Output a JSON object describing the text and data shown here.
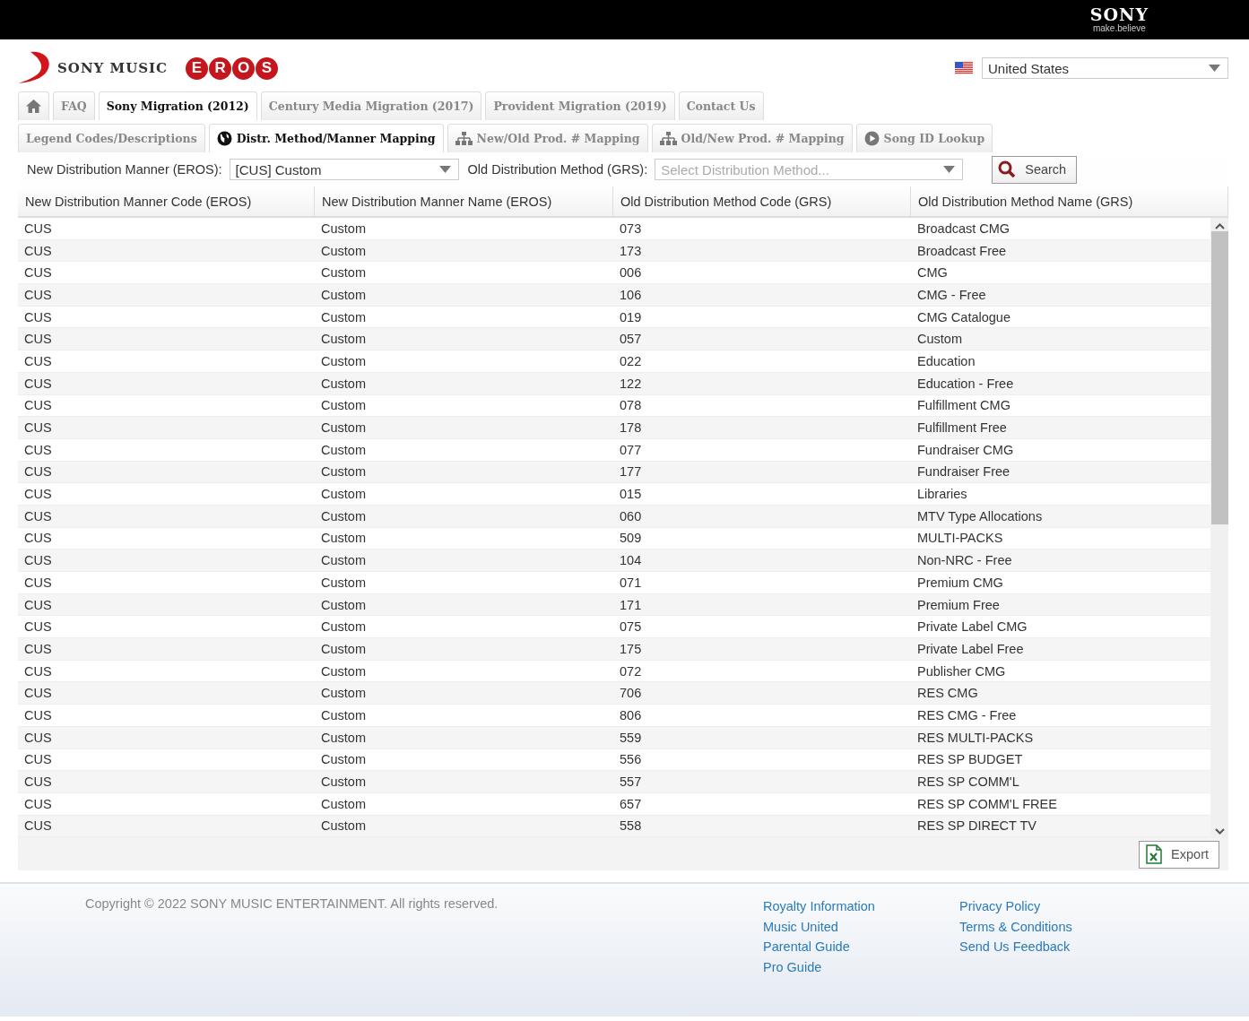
{
  "top_bar": {
    "brand": "SONY",
    "tagline": "make.believe"
  },
  "header": {
    "company": "SONY MUSIC",
    "product_letters": [
      "E",
      "R",
      "O",
      "S"
    ],
    "country": {
      "value": "United States"
    }
  },
  "main_tabs": [
    {
      "kind": "icon",
      "selected": false
    },
    {
      "kind": "text",
      "label": "FAQ",
      "selected": false
    },
    {
      "kind": "text",
      "label": "Sony Migration (2012)",
      "selected": true
    },
    {
      "kind": "text",
      "label": "Century Media Migration (2017)",
      "selected": false
    },
    {
      "kind": "text",
      "label": "Provident Migration (2019)",
      "selected": false
    },
    {
      "kind": "text",
      "label": "Contact Us",
      "selected": false
    }
  ],
  "sub_tabs": [
    {
      "label": "Legend Codes/Descriptions",
      "selected": false
    },
    {
      "label": "Distr. Method/Manner Mapping",
      "selected": true
    },
    {
      "label": "New/Old Prod. # Mapping",
      "selected": false
    },
    {
      "label": "Old/New Prod. # Mapping",
      "selected": false
    },
    {
      "label": "Song ID Lookup",
      "selected": false
    }
  ],
  "filters": [
    {
      "label": "New Distribution Manner (EROS):",
      "value": "[CUS] Custom"
    },
    {
      "label": "Old Distribution Method (GRS):",
      "placeholder": "Select Distribution Method..."
    }
  ],
  "search_button": "Search",
  "table": {
    "columns": [
      "New Distribution Manner Code (EROS)",
      "New Distribution Manner Name (EROS)",
      "Old Distribution Method Code (GRS)",
      "Old Distribution Method Name (GRS)"
    ],
    "rows": [
      [
        "CUS",
        "Custom",
        "073",
        "Broadcast CMG"
      ],
      [
        "CUS",
        "Custom",
        "173",
        "Broadcast Free"
      ],
      [
        "CUS",
        "Custom",
        "006",
        "CMG"
      ],
      [
        "CUS",
        "Custom",
        "106",
        "CMG - Free"
      ],
      [
        "CUS",
        "Custom",
        "019",
        "CMG Catalogue"
      ],
      [
        "CUS",
        "Custom",
        "057",
        "Custom"
      ],
      [
        "CUS",
        "Custom",
        "022",
        "Education"
      ],
      [
        "CUS",
        "Custom",
        "122",
        "Education - Free"
      ],
      [
        "CUS",
        "Custom",
        "078",
        "Fulfillment CMG"
      ],
      [
        "CUS",
        "Custom",
        "178",
        "Fulfillment Free"
      ],
      [
        "CUS",
        "Custom",
        "077",
        "Fundraiser CMG"
      ],
      [
        "CUS",
        "Custom",
        "177",
        "Fundraiser Free"
      ],
      [
        "CUS",
        "Custom",
        "015",
        "Libraries"
      ],
      [
        "CUS",
        "Custom",
        "060",
        "MTV Type Allocations"
      ],
      [
        "CUS",
        "Custom",
        "509",
        "MULTI-PACKS"
      ],
      [
        "CUS",
        "Custom",
        "104",
        "Non-NRC - Free"
      ],
      [
        "CUS",
        "Custom",
        "071",
        "Premium CMG"
      ],
      [
        "CUS",
        "Custom",
        "171",
        "Premium Free"
      ],
      [
        "CUS",
        "Custom",
        "075",
        "Private Label CMG"
      ],
      [
        "CUS",
        "Custom",
        "175",
        "Private Label Free"
      ],
      [
        "CUS",
        "Custom",
        "072",
        "Publisher CMG"
      ],
      [
        "CUS",
        "Custom",
        "706",
        "RES CMG"
      ],
      [
        "CUS",
        "Custom",
        "806",
        "RES CMG - Free"
      ],
      [
        "CUS",
        "Custom",
        "559",
        "RES MULTI-PACKS"
      ],
      [
        "CUS",
        "Custom",
        "556",
        "RES SP BUDGET"
      ],
      [
        "CUS",
        "Custom",
        "557",
        "RES SP COMM'L"
      ],
      [
        "CUS",
        "Custom",
        "657",
        "RES SP COMM'L FREE"
      ],
      [
        "CUS",
        "Custom",
        "558",
        "RES SP DIRECT TV"
      ]
    ]
  },
  "export_button": "Export",
  "footer": {
    "copyright": "Copyright © 2022 SONY MUSIC ENTERTAINMENT. All rights reserved.",
    "links_1": [
      "Royalty Information",
      "Music United",
      "Parental Guide",
      "Pro Guide"
    ],
    "links_2": [
      "Privacy Policy",
      "Terms & Conditions",
      "Send Us Feedback"
    ]
  }
}
